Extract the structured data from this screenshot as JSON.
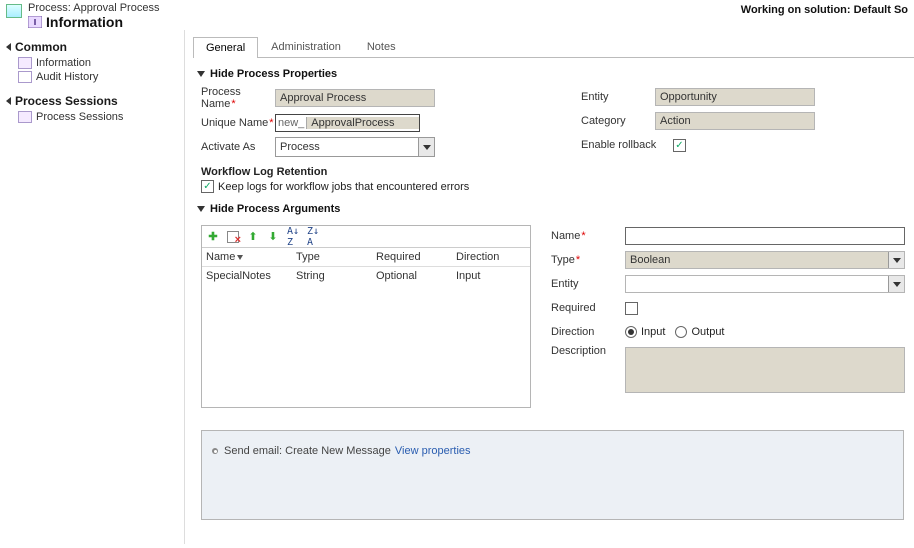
{
  "header": {
    "process_prefix": "Process:",
    "process_name": "Approval Process",
    "title": "Information",
    "working_on": "Working on solution: Default So"
  },
  "sidebar": {
    "sections": [
      {
        "label": "Common",
        "items": [
          {
            "label": "Information"
          },
          {
            "label": "Audit History"
          }
        ]
      },
      {
        "label": "Process Sessions",
        "items": [
          {
            "label": "Process Sessions"
          }
        ]
      }
    ]
  },
  "tabs": {
    "general": "General",
    "admin": "Administration",
    "notes": "Notes"
  },
  "propSection": "Hide Process Properties",
  "props": {
    "process_name_label": "Process Name",
    "process_name_value": "Approval Process",
    "unique_name_label": "Unique Name",
    "unique_name_prefix": "new_",
    "unique_name_value": "ApprovalProcess",
    "activate_as_label": "Activate As",
    "activate_as_value": "Process",
    "entity_label": "Entity",
    "entity_value": "Opportunity",
    "category_label": "Category",
    "category_value": "Action",
    "enable_rollback_label": "Enable rollback",
    "log_header": "Workflow Log Retention",
    "log_cb": "Keep logs for workflow jobs that encountered errors"
  },
  "argsSection": "Hide Process Arguments",
  "grid": {
    "headers": {
      "name": "Name",
      "type": "Type",
      "required": "Required",
      "direction": "Direction"
    },
    "rows": [
      {
        "name": "SpecialNotes",
        "type": "String",
        "required": "Optional",
        "direction": "Input"
      }
    ]
  },
  "argForm": {
    "name_label": "Name",
    "type_label": "Type",
    "type_value": "Boolean",
    "entity_label": "Entity",
    "required_label": "Required",
    "direction_label": "Direction",
    "direction_input": "Input",
    "direction_output": "Output",
    "description_label": "Description"
  },
  "step": {
    "text": "Send email:  Create New Message",
    "link": "View properties"
  }
}
